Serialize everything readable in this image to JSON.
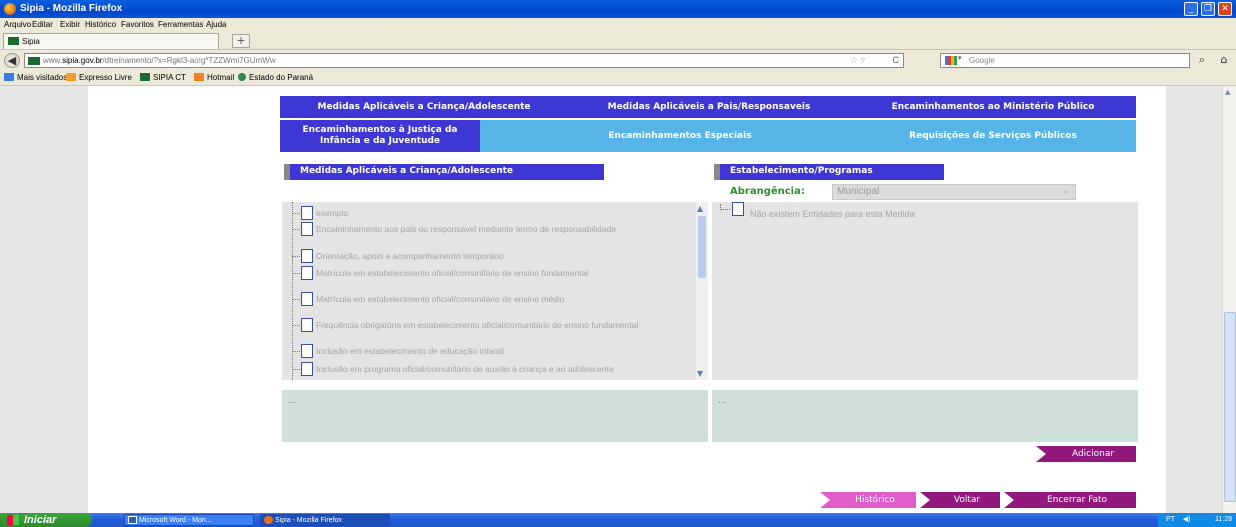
{
  "window": {
    "title": "Sipia - Mozilla Firefox"
  },
  "menubar": {
    "items": [
      "Arquivo",
      "Editar",
      "Exibir",
      "Histórico",
      "Favoritos",
      "Ferramentas",
      "Ajuda"
    ]
  },
  "tabs": [
    {
      "label": "Sipia"
    }
  ],
  "navbar": {
    "url_prefix": "www.",
    "url_host": "sipia.gov.br",
    "url_path": "/dtreinamento/?x=Rgkl3-ao!g*TZZWmi7GUmWw",
    "search_placeholder": "Google"
  },
  "bookmarks": [
    {
      "label": "Mais visitados",
      "color": "#3a7be8"
    },
    {
      "label": "Expresso Livre",
      "color": "#f0a030"
    },
    {
      "label": "SIPIA CT",
      "color": "#1b6b2e"
    },
    {
      "label": "Hotmail",
      "color": "#f08020"
    },
    {
      "label": "Estado do Paraná",
      "color": "#2e8b57"
    }
  ],
  "nav": {
    "row1": [
      "Medidas Aplicáveis a Criança/Adolescente",
      "Medidas Aplicáveis a Pais/Responsaveis",
      "Encaminhamentos ao Ministério Público"
    ],
    "row2": [
      "Encaminhamentos à Justiça da Infância e da Juventude",
      "Encaminhamentos Especiais",
      "Requisições de Serviços Públicos"
    ]
  },
  "left_panel": {
    "header": "Medidas Aplicáveis a Criança/Adolescente",
    "items": [
      "exemplo",
      "Encaminhamento aos pais ou responsável mediante termo de responsabilidade",
      "Orientação, apoio e acompanhamento temporário",
      "Matrícula em estabelecimento oficial/comunitário de ensino fundamental",
      "Matrícula em estabelecimento oficial/comunitário de ensino médio",
      "Frequência obrigatória em estabelecimento oficial/comunitário de ensino fundamental",
      "Inclusão em estabelecimento de educação infantil",
      "Inclusão em programa oficial/comunitário de auxílio à criança e ao adolescente"
    ],
    "detail": "..."
  },
  "right_panel": {
    "header": "Estabelecimento/Programas",
    "abrangencia_label": "Abrangência:",
    "abrangencia_value": "Municipal",
    "empty_message": "Não existem Entidades para esta Medida",
    "detail": "..."
  },
  "actions": {
    "adicionar": "Adicionar",
    "historico": "Histórico",
    "voltar": "Voltar",
    "encerrar": "Encerrar Fato"
  },
  "taskbar": {
    "start": "Iniciar",
    "items": [
      {
        "label": "Microsoft Word - Mon...",
        "color": "#2d5fc0"
      },
      {
        "label": "Sipia - Mozilla Firefox",
        "color": "#e8731a"
      }
    ],
    "tray_lang": "PT",
    "clock": "11:28"
  },
  "colors": {
    "nav_dark": "#3e37d3",
    "nav_light": "#57b4e6",
    "action": "#93187d",
    "action_light": "#e05cc9",
    "label_green": "#2a8f2a",
    "detail_bg": "#cfe0d8"
  }
}
